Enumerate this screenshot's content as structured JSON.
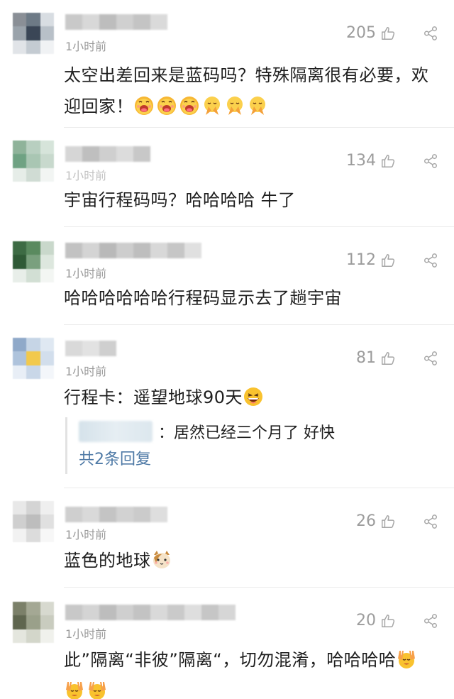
{
  "comments": [
    {
      "time": "1小时前",
      "likes": "205",
      "text": "太空出差回来是蓝码吗？特殊隔离很有必要，欢迎回家！",
      "emojis": [
        "hungry-face-emoji",
        "hungry-face-emoji",
        "hungry-face-emoji",
        "pray-hands-emoji",
        "pray-hands-emoji",
        "pray-hands-emoji"
      ]
    },
    {
      "time": "1小时前",
      "likes": "134",
      "text": "宇宙行程码吗？哈哈哈哈 牛了",
      "emojis": []
    },
    {
      "time": "1小时前",
      "likes": "112",
      "text": "哈哈哈哈哈哈行程码显示去了趟宇宙",
      "emojis": []
    },
    {
      "time": "1小时前",
      "likes": "81",
      "text": "行程卡：遥望地球90天",
      "emojis": [
        "laughing-face-emoji"
      ],
      "reply": {
        "text": "：居然已经三个月了 好快",
        "more": "共2条回复"
      }
    },
    {
      "time": "1小时前",
      "likes": "26",
      "text": "蓝色的地球",
      "emojis": [
        "cat-face-emoji"
      ]
    },
    {
      "time": "1小时前",
      "likes": "20",
      "text": "此”隔离“非彼”隔离“，切勿混淆，哈哈哈哈",
      "emojis": [
        "victory-hands-emoji",
        "victory-hands-emoji",
        "victory-hands-emoji"
      ]
    }
  ]
}
